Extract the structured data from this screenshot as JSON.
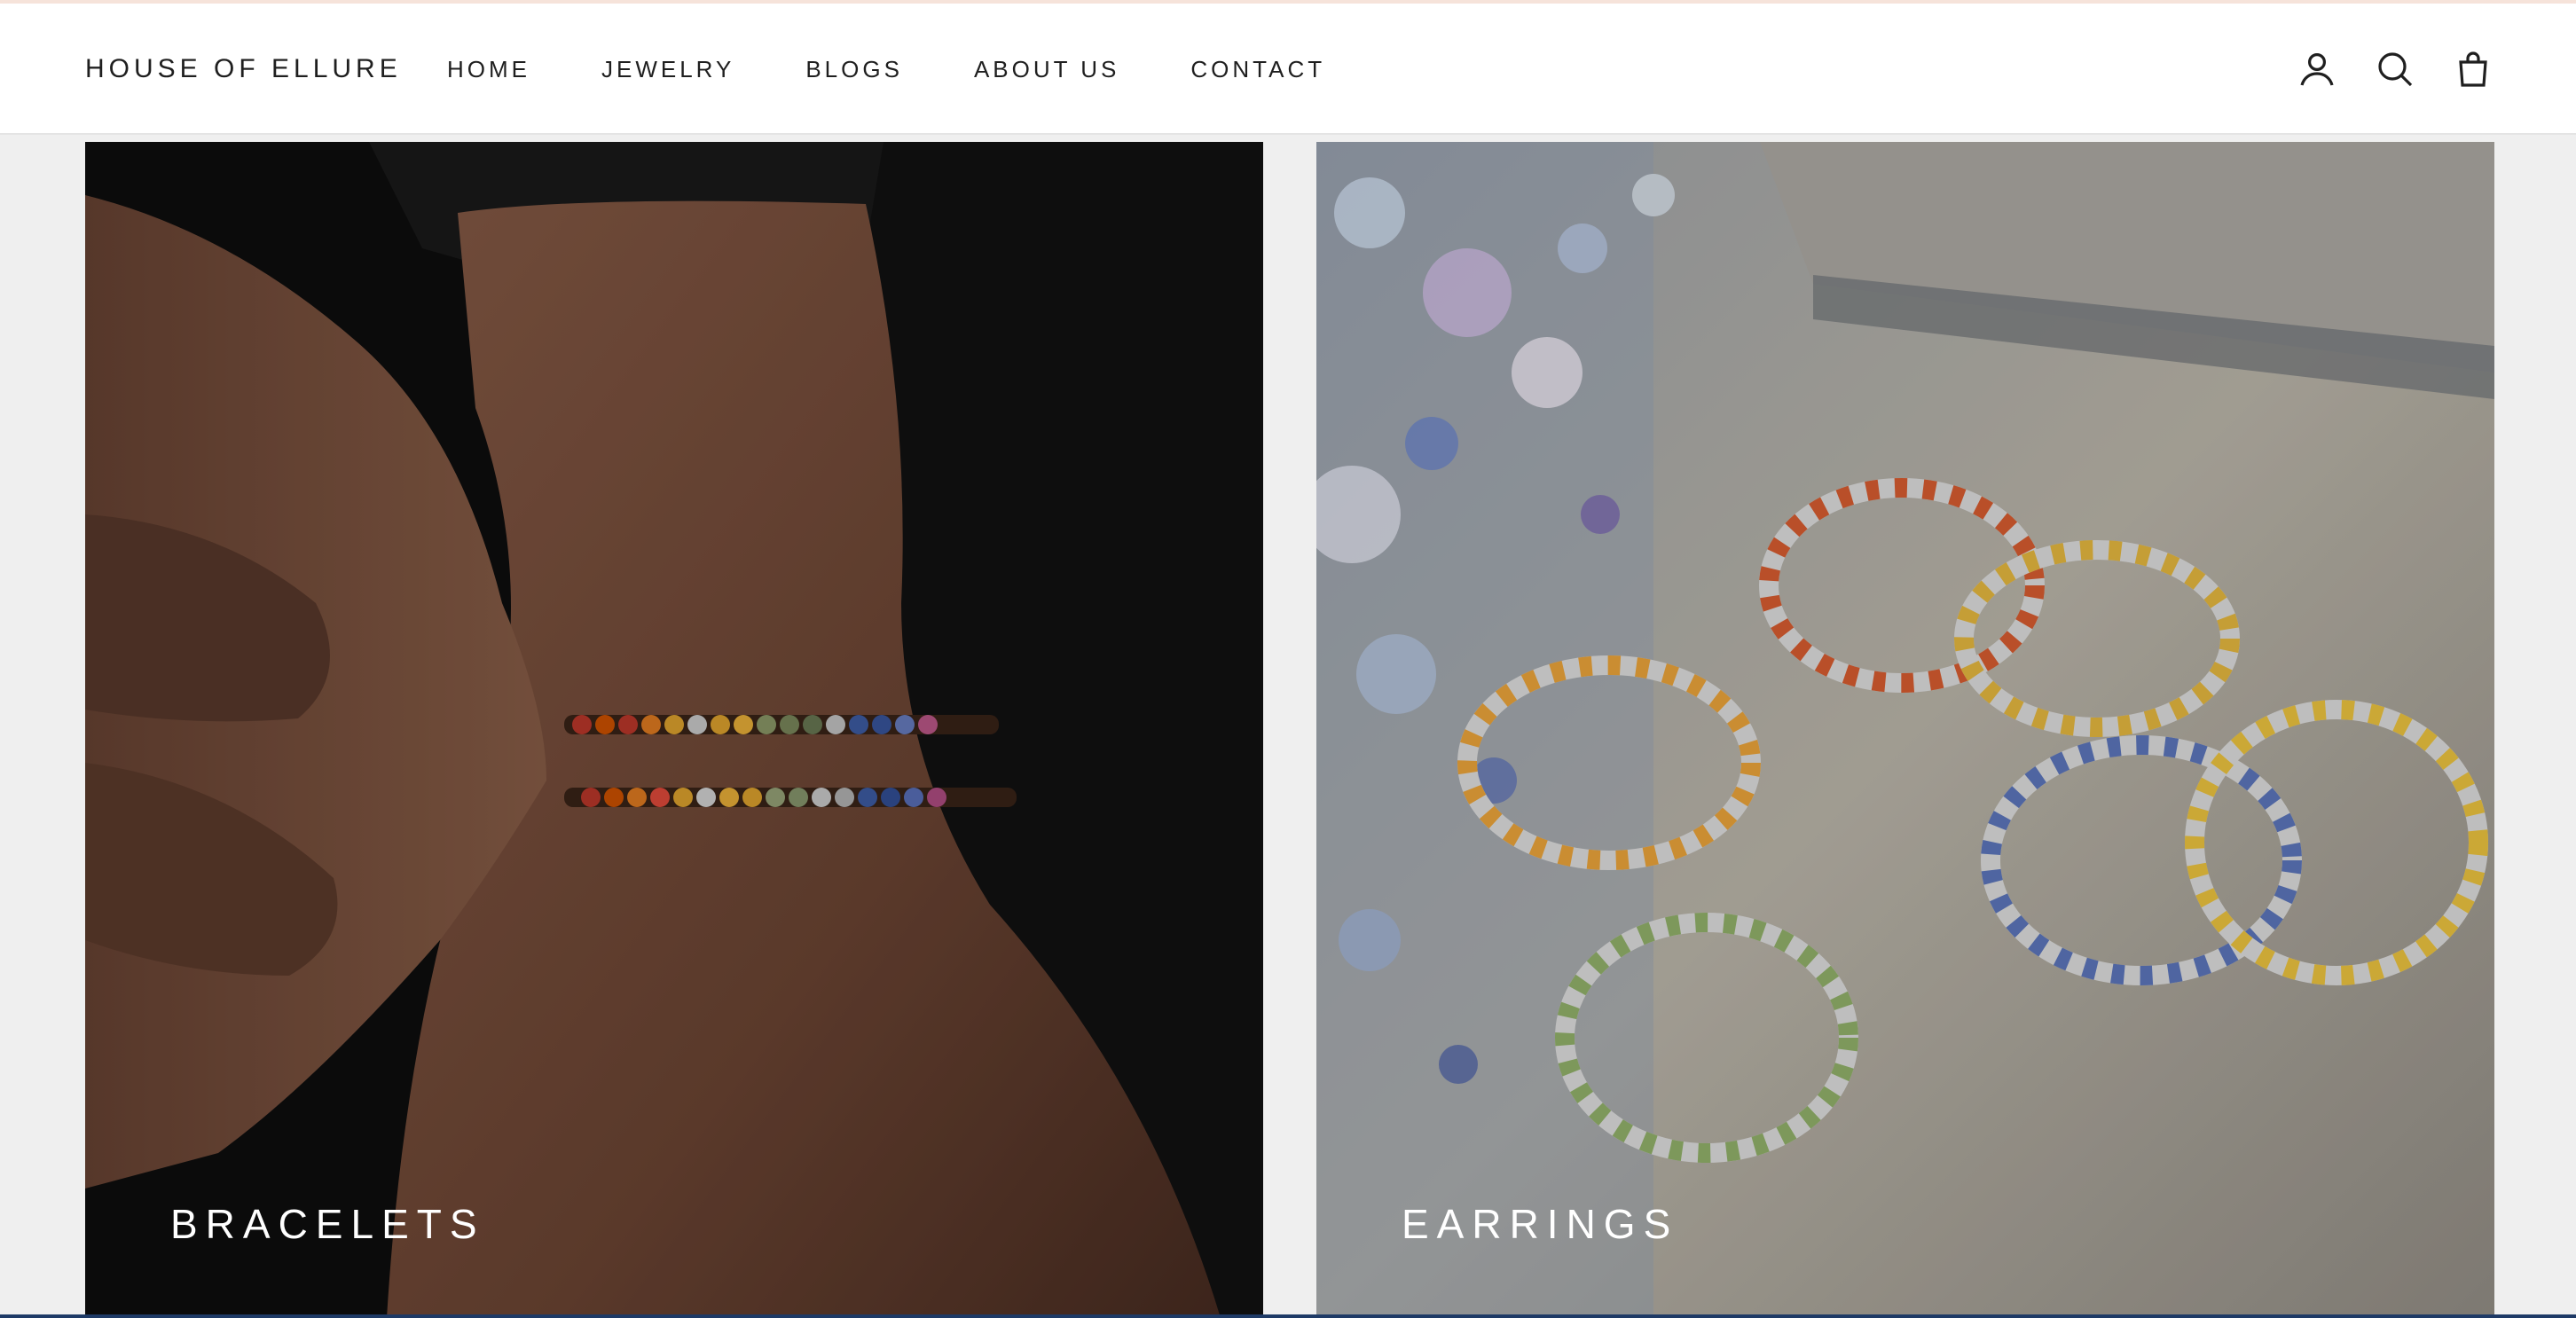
{
  "header": {
    "brand": "HOUSE OF ELLURE",
    "nav": [
      "HOME",
      "JEWELRY",
      "BLOGS",
      "ABOUT US",
      "CONTACT"
    ],
    "icons": [
      "account-icon",
      "search-icon",
      "cart-icon"
    ]
  },
  "collections": [
    {
      "label": "BRACELETS"
    },
    {
      "label": "EARRINGS"
    }
  ],
  "colors": {
    "header_bg": "#ffffff",
    "page_bg": "#efefef",
    "text": "#1f1f1f",
    "tile_label": "#ffffff"
  }
}
